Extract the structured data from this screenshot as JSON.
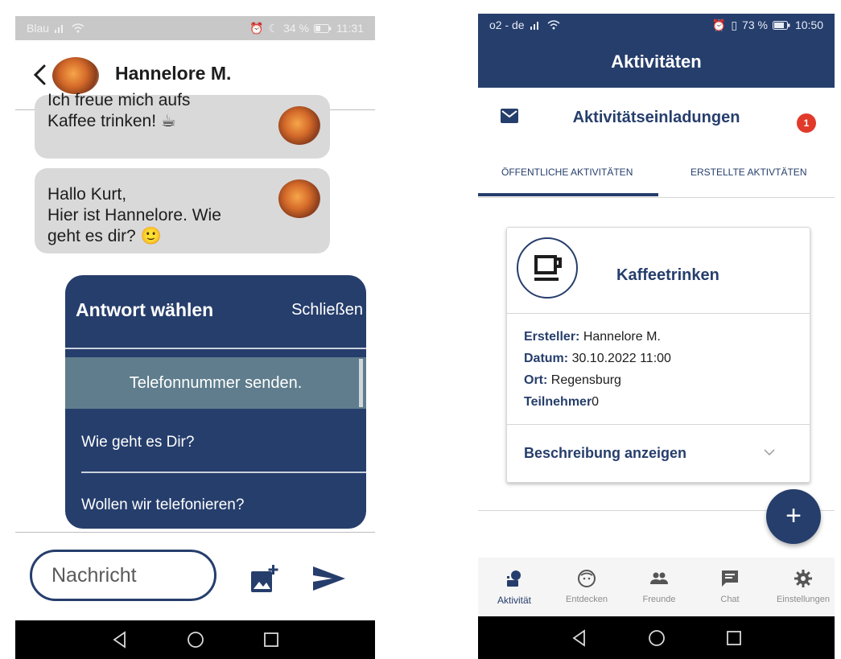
{
  "left_screen": {
    "status": {
      "carrier": "Blau",
      "battery": "34 %",
      "time": "11:31"
    },
    "chat": {
      "contact_name": "Hannelore M.",
      "messages": [
        {
          "text": "Ich freue mich aufs Kaffee trinken! ☕"
        },
        {
          "text": "Hallo Kurt,\nHier ist Hannelore. Wie geht es dir? 🙂"
        }
      ]
    },
    "reply_panel": {
      "title": "Antwort wählen",
      "close_label": "Schließen",
      "options": [
        "Telefonnummer senden.",
        "Wie geht es Dir?",
        "Wollen wir telefonieren?"
      ]
    },
    "compose": {
      "placeholder": "Nachricht"
    }
  },
  "right_screen": {
    "status": {
      "carrier": "o2 - de",
      "battery": "73 %",
      "time": "10:50"
    },
    "app_title": "Aktivitäten",
    "invites": {
      "label": "Aktivitätseinladungen",
      "badge_count": "1"
    },
    "tabs": [
      "ÖFFENTLICHE AKTIVITÄTEN",
      "ERSTELLTE AKTIVTÄTEN"
    ],
    "active_tab": "ÖFFENTLICHE AKTIVITÄTEN",
    "card": {
      "title": "Kaffeetrinken",
      "creator_key": "Ersteller:",
      "creator_value": "Hannelore M.",
      "date_key": "Datum:",
      "date_value": "30.10.2022 11:00",
      "place_key": "Ort:",
      "place_value": "Regensburg",
      "participants_key": "Teilnehmer",
      "participants_value": "0",
      "description_label": "Beschreibung anzeigen"
    },
    "fab_label": "+",
    "bottom_nav": [
      "Aktivität",
      "Entdecken",
      "Freunde",
      "Chat",
      "Einstellungen"
    ]
  },
  "colors": {
    "primary": "#263e6c",
    "bubble": "#d9d9d9",
    "reply_active": "#5f7d8c",
    "badge": "#e13a2a"
  }
}
